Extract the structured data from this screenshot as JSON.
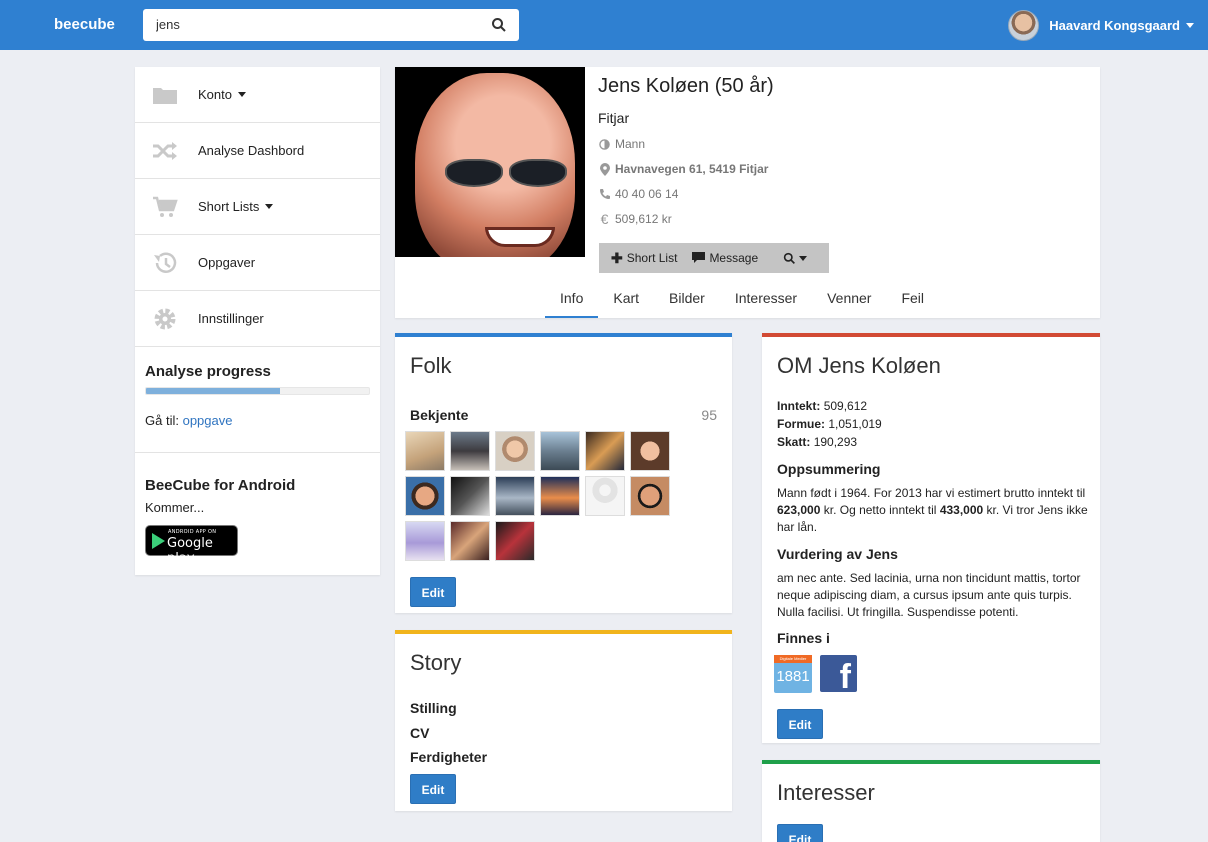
{
  "navbar": {
    "brand": "beecube",
    "search_value": "jens",
    "user_name": "Haavard Kongsgaard"
  },
  "sidebar": {
    "items": [
      {
        "label": "Konto",
        "icon": "folder-icon",
        "dropdown": true
      },
      {
        "label": "Analyse Dashbord",
        "icon": "shuffle-icon",
        "dropdown": false
      },
      {
        "label": "Short Lists",
        "icon": "cart-icon",
        "dropdown": true
      },
      {
        "label": "Oppgaver",
        "icon": "history-icon",
        "dropdown": false
      },
      {
        "label": "Innstillinger",
        "icon": "gear-icon",
        "dropdown": false
      }
    ],
    "progress": {
      "title": "Analyse progress",
      "fraction": 0.6,
      "goto_prefix": "Gå til:",
      "goto_link": "oppgave"
    },
    "android": {
      "title": "BeeCube for Android",
      "subtitle": "Kommer...",
      "badge_top": "ANDROID APP ON",
      "badge_main": "Google play"
    }
  },
  "profile": {
    "name": "Jens Koløen (50 år)",
    "city": "Fitjar",
    "gender": "Mann",
    "address": "Havnavegen 61, 5419 Fitjar",
    "phone": "40 40 06 14",
    "income": "509,612 kr",
    "actions": {
      "shortlist": "Short List",
      "message": "Message"
    },
    "tabs": [
      "Info",
      "Kart",
      "Bilder",
      "Interesser",
      "Venner",
      "Feil"
    ],
    "active_tab": "Info"
  },
  "folk": {
    "title": "Folk",
    "section": "Bekjente",
    "count": "95",
    "edit": "Edit"
  },
  "story": {
    "title": "Story",
    "items": [
      "Stilling",
      "CV",
      "Ferdigheter"
    ],
    "edit": "Edit"
  },
  "om": {
    "title": "OM Jens Koløen",
    "inntekt_label": "Inntekt:",
    "inntekt": "509,612",
    "formue_label": "Formue:",
    "formue": "1,051,019",
    "skatt_label": "Skatt:",
    "skatt": "190,293",
    "oppsummering_title": "Oppsummering",
    "oppsummering_1": "Mann født i 1964. For 2013 har vi estimert brutto inntekt til",
    "oppsummering_b1": "623,000",
    "oppsummering_2": "kr. Og netto inntekt til",
    "oppsummering_b2": "433,000",
    "oppsummering_3": "kr. Vi tror Jens ikke har lån.",
    "vurdering_title": "Vurdering av Jens",
    "vurdering_text": "am nec ante. Sed lacinia, urna non tincidunt mattis, tortor neque adipiscing diam, a cursus ipsum ante quis turpis. Nulla facilisi. Ut fringilla. Suspendisse potenti.",
    "finnes_title": "Finnes i",
    "logo_1881_top": "Digitale Medier",
    "logo_1881": "1881",
    "logo_fb": "f",
    "edit": "Edit"
  },
  "interesser": {
    "title": "Interesser",
    "edit": "Edit"
  },
  "colors": {
    "primary": "#2f80d1",
    "folk_accent": "#2f80d1",
    "story_accent": "#f1b41c",
    "om_accent": "#d24a34",
    "interesser_accent": "#1fa04a"
  }
}
